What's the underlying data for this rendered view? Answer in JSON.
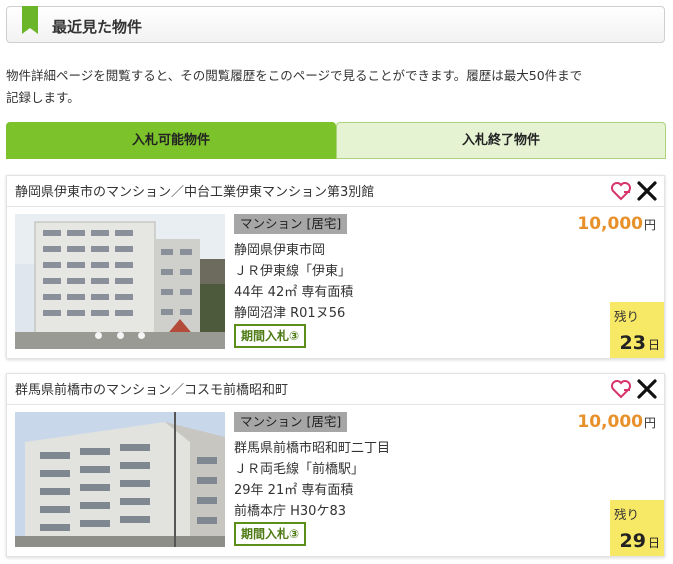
{
  "header": {
    "title": "最近見た物件"
  },
  "intro": {
    "line1": "物件詳細ページを閲覧すると、その閲覧履歴をこのページで見ることができます。履歴は最大50件まで",
    "line2": "記録します。"
  },
  "tabs": [
    {
      "label": "入札可能物件",
      "active": true
    },
    {
      "label": "入札終了物件",
      "active": false
    }
  ],
  "colors": {
    "accent": "#7bc22b",
    "price": "#e8902a",
    "remain_bg": "#f7e866",
    "fav": "#d6336c"
  },
  "listings": [
    {
      "title": "静岡県伊東市のマンション／中台工業伊東マンション第3別館",
      "type": "マンション [居宅]",
      "address": "静岡県伊東市岡",
      "station": "ＪＲ伊東線「伊東」",
      "size": "44年 42㎡ 専有面積",
      "case": "静岡沼津 R01ヌ56",
      "period": "期間入札③",
      "price": "10,000",
      "price_unit": "円",
      "remain_label": "残り",
      "remain_days": "23",
      "remain_unit": "日"
    },
    {
      "title": "群馬県前橋市のマンション／コスモ前橋昭和町",
      "type": "マンション [居宅]",
      "address": "群馬県前橋市昭和町二丁目",
      "station": "ＪＲ両毛線「前橋駅」",
      "size": "29年 21㎡ 専有面積",
      "case": "前橋本庁 H30ケ83",
      "period": "期間入札③",
      "price": "10,000",
      "price_unit": "円",
      "remain_label": "残り",
      "remain_days": "29",
      "remain_unit": "日"
    }
  ]
}
